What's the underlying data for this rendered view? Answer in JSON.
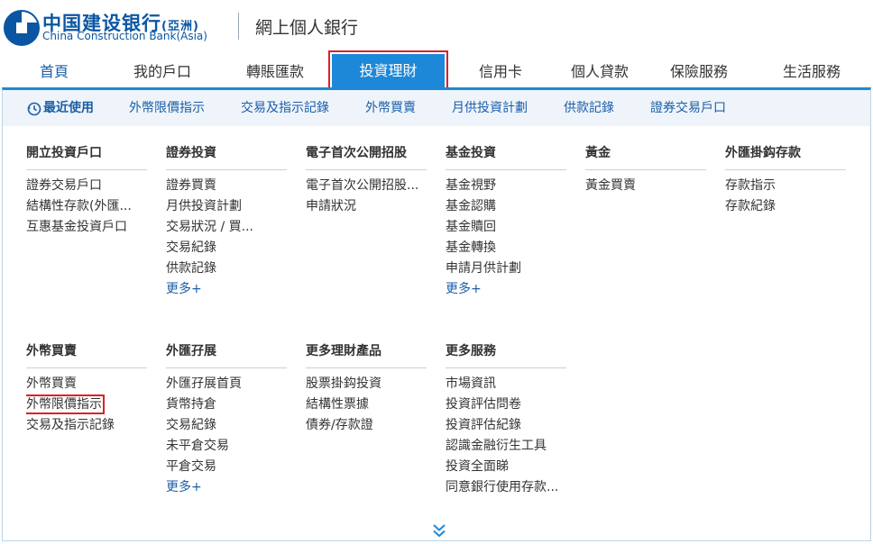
{
  "brand": {
    "name_cn": "中国建设银行",
    "name_cn_sub": "(亞洲)",
    "name_en": "China Construction Bank(Asia)",
    "site_title": "網上個人銀行",
    "brand_color": "#0b56a3"
  },
  "mainnav": {
    "items": [
      "首頁",
      "我的戶口",
      "轉賬匯款",
      "投資理財",
      "信用卡",
      "個人貸款",
      "保險服務",
      "生活服務"
    ],
    "active_index": 3,
    "active_color": "#1e88d8",
    "highlight_color": "#d9222a"
  },
  "recent": {
    "title": "最近使用",
    "icon": "clock-icon",
    "items": [
      "外幣限價指示",
      "交易及指示記錄",
      "外幣買賣",
      "月供投資計劃",
      "供款記錄",
      "證券交易戶口"
    ]
  },
  "menu": {
    "row1": [
      {
        "heading": "開立投資戶口",
        "items": [
          "證券交易戶口",
          "結構性存款(外匯...",
          "互惠基金投資戶口"
        ]
      },
      {
        "heading": "證券投資",
        "items": [
          "證券買賣",
          "月供投資計劃",
          "交易狀況 / 買...",
          "交易紀錄",
          "供款記錄"
        ],
        "more": "更多+"
      },
      {
        "heading": "電子首次公開招股",
        "items": [
          "電子首次公開招股...",
          "申請狀況"
        ]
      },
      {
        "heading": "基金投資",
        "items": [
          "基金視野",
          "基金認購",
          "基金贖回",
          "基金轉換",
          "申請月供計劃"
        ],
        "more": "更多+"
      },
      {
        "heading": "黃金",
        "items": [
          "黃金買賣"
        ]
      },
      {
        "heading": "外匯掛鈎存款",
        "items": [
          "存款指示",
          "存款紀錄"
        ]
      }
    ],
    "row2": [
      {
        "heading": "外幣買賣",
        "items": [
          "外幣買賣",
          "外幣限價指示",
          "交易及指示記錄"
        ]
      },
      {
        "heading": "外匯孖展",
        "items": [
          "外匯孖展首頁",
          "貨幣持倉",
          "交易紀錄",
          "未平倉交易",
          "平倉交易"
        ],
        "more": "更多+"
      },
      {
        "heading": "更多理財產品",
        "items": [
          "股票掛鈎投資",
          "結構性票據",
          "債券/存款證"
        ]
      },
      {
        "heading": "更多服務",
        "items": [
          "市場資訊",
          "投資評估問卷",
          "投資評估紀錄",
          "認識金融衍生工具",
          "投資全面睇",
          "同意銀行使用存款..."
        ]
      }
    ]
  },
  "scroll_icon": "double-chevron-down-icon"
}
